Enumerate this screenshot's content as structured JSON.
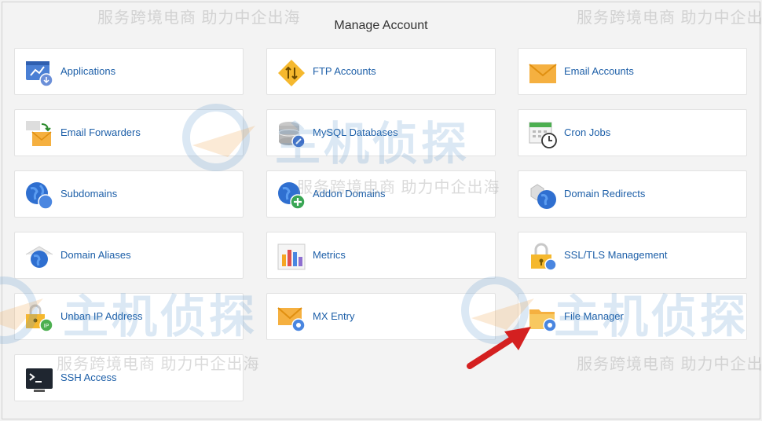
{
  "title": "Manage Account",
  "tiles": [
    {
      "label": "Applications",
      "icon": "applications-icon"
    },
    {
      "label": "FTP Accounts",
      "icon": "ftp-icon"
    },
    {
      "label": "Email Accounts",
      "icon": "email-accounts-icon"
    },
    {
      "label": "Email Forwarders",
      "icon": "email-forwarders-icon"
    },
    {
      "label": "MySQL Databases",
      "icon": "database-icon"
    },
    {
      "label": "Cron Jobs",
      "icon": "cron-jobs-icon"
    },
    {
      "label": "Subdomains",
      "icon": "globe-icon"
    },
    {
      "label": "Addon Domains",
      "icon": "globe-add-icon"
    },
    {
      "label": "Domain Redirects",
      "icon": "domain-redirects-icon"
    },
    {
      "label": "Domain Aliases",
      "icon": "domain-aliases-icon"
    },
    {
      "label": "Metrics",
      "icon": "bar-chart-icon"
    },
    {
      "label": "SSL/TLS Management",
      "icon": "ssl-lock-icon"
    },
    {
      "label": "Unban IP Address",
      "icon": "unban-ip-icon"
    },
    {
      "label": "MX Entry",
      "icon": "mx-entry-icon"
    },
    {
      "label": "File Manager",
      "icon": "folder-icon"
    },
    {
      "label": "SSH Access",
      "icon": "terminal-icon"
    }
  ],
  "watermark": {
    "text": "服务跨境电商 助力中企出海",
    "logo_text": "主机侦探"
  },
  "colors": {
    "link": "#1d5fa8",
    "arrow": "#d42020"
  }
}
